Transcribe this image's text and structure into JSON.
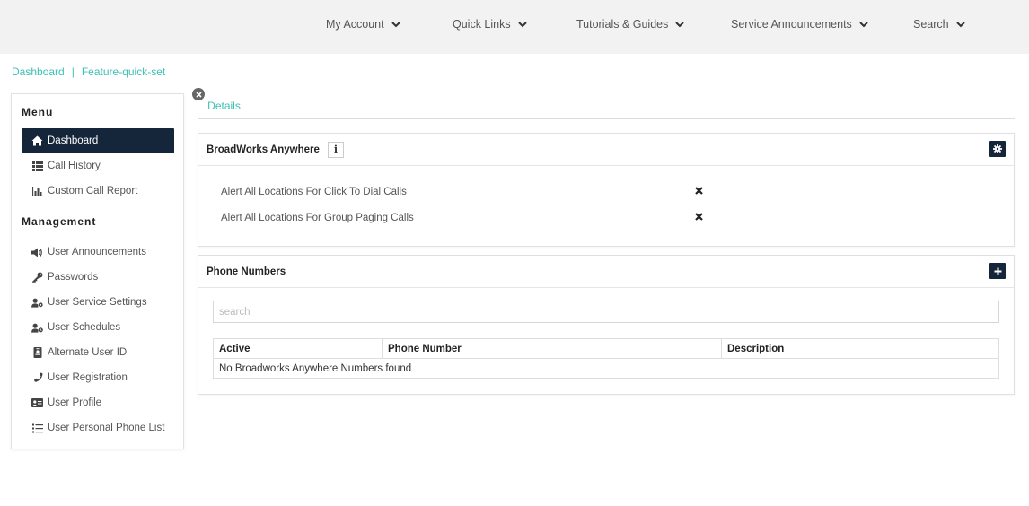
{
  "nav": {
    "items": [
      {
        "label": "My Account",
        "icon": "chevron-down-icon"
      },
      {
        "label": "Quick Links",
        "icon": "chevron-down-icon"
      },
      {
        "label": "Tutorials & Guides",
        "icon": "chevron-down-icon"
      },
      {
        "label": "Service Announcements",
        "icon": "chevron-down-icon"
      },
      {
        "label": "Search",
        "icon": "chevron-down-icon"
      }
    ]
  },
  "breadcrumb": {
    "items": [
      "Dashboard",
      "Feature-quick-set"
    ],
    "separator": "|"
  },
  "sidebar": {
    "menu_heading": "Menu",
    "menu_items": [
      {
        "label": "Dashboard",
        "icon": "home-icon",
        "active": true
      },
      {
        "label": "Call History",
        "icon": "list-table-icon"
      },
      {
        "label": "Custom Call Report",
        "icon": "bar-chart-icon"
      }
    ],
    "management_heading": "Management",
    "management_items": [
      {
        "label": "User Announcements",
        "icon": "megaphone-icon"
      },
      {
        "label": "Passwords",
        "icon": "key-icon"
      },
      {
        "label": "User Service Settings",
        "icon": "user-cog-icon"
      },
      {
        "label": "User Schedules",
        "icon": "user-clock-icon"
      },
      {
        "label": "Alternate User ID",
        "icon": "id-badge-icon"
      },
      {
        "label": "User Registration",
        "icon": "phone-icon"
      },
      {
        "label": "User Profile",
        "icon": "id-card-icon"
      },
      {
        "label": "User Personal Phone List",
        "icon": "list-icon"
      }
    ]
  },
  "tabs": [
    {
      "label": "Details",
      "active": true
    }
  ],
  "broadworks_panel": {
    "title": "BroadWorks Anywhere",
    "info_label": "i",
    "settings": [
      {
        "label": "Alert All Locations For Click To Dial Calls",
        "enabled": false
      },
      {
        "label": "Alert All Locations For Group Paging Calls",
        "enabled": false
      }
    ]
  },
  "phone_panel": {
    "title": "Phone Numbers",
    "search_placeholder": "search",
    "columns": [
      "Active",
      "Phone Number",
      "Description"
    ],
    "empty_message": "No Broadworks Anywhere Numbers found"
  },
  "colors": {
    "accent": "#3cc0b4",
    "dark": "#15253a",
    "topbar": "#f2f2f2"
  }
}
